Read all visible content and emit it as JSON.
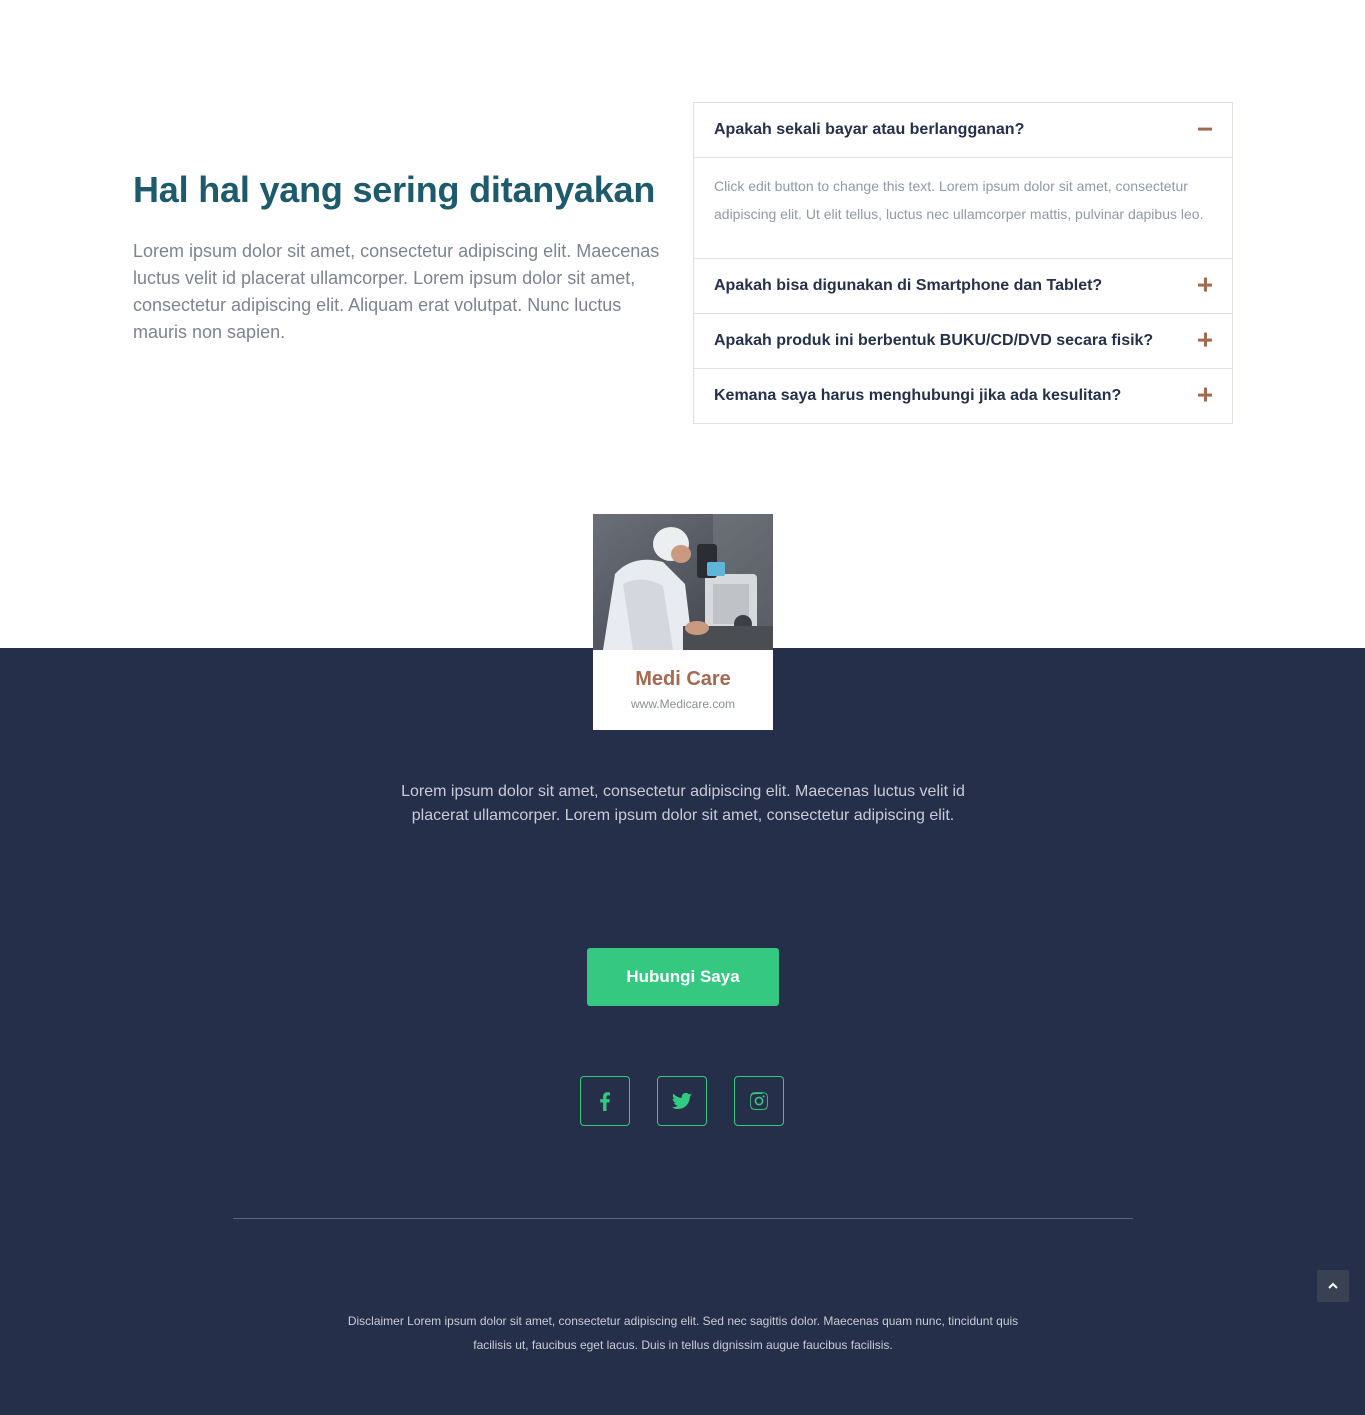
{
  "faq": {
    "heading": "Hal hal yang sering ditanyakan",
    "description": "Lorem ipsum dolor sit amet, consectetur adipiscing elit. Maecenas luctus velit id placerat ullamcorper. Lorem ipsum dolor sit amet, consectetur adipiscing elit. Aliquam erat volutpat. Nunc luctus mauris non sapien.",
    "items": [
      {
        "question": "Apakah sekali bayar atau berlangganan?",
        "expanded": true,
        "answer": "Click edit button to change this text. Lorem ipsum dolor sit amet, consectetur adipiscing elit. Ut elit tellus, luctus nec ullamcorper mattis, pulvinar dapibus leo.",
        "icon": "minus-icon"
      },
      {
        "question": "Apakah bisa digunakan di Smartphone dan Tablet?",
        "expanded": false,
        "icon": "plus-icon"
      },
      {
        "question": "Apakah produk ini berbentuk BUKU/CD/DVD secara fisik?",
        "expanded": false,
        "icon": "plus-icon"
      },
      {
        "question": "Kemana saya harus menghubungi jika ada kesulitan?",
        "expanded": false,
        "icon": "plus-icon"
      }
    ]
  },
  "brand": {
    "name": "Medi Care",
    "url": "www.Medicare.com",
    "image": "scientist-microscope-photo"
  },
  "footer": {
    "description": "Lorem ipsum dolor sit amet, consectetur adipiscing elit. Maecenas luctus velit id placerat ullamcorper. Lorem ipsum dolor sit amet, consectetur adipiscing elit.",
    "cta_label": "Hubungi Saya",
    "social": [
      "facebook-icon",
      "twitter-icon",
      "instagram-icon"
    ],
    "disclaimer": "Disclaimer Lorem ipsum dolor sit amet, consectetur adipiscing elit. Sed nec sagittis dolor. Maecenas quam nunc, tincidunt quis facilisis ut, faucibus eget lacus. Duis in tellus dignissim augue faucibus facilisis."
  },
  "colors": {
    "heading": "#1d5a6b",
    "accent_brown": "#a5694f",
    "dark_bg": "#262f4a",
    "green": "#34c880"
  }
}
